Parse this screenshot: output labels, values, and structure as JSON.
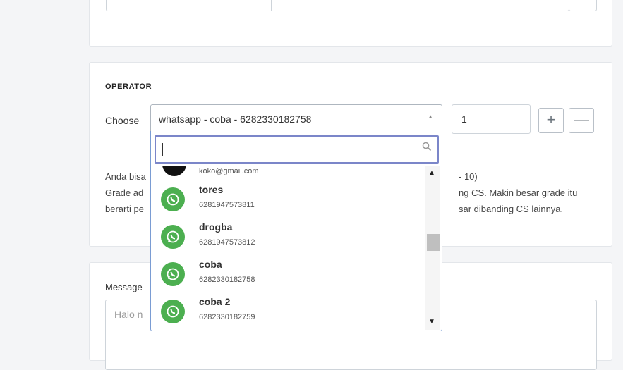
{
  "operator_section": {
    "title": "OPERATOR",
    "choose_label": "Choose",
    "selected_operator": "whatsapp - coba - 6282330182758",
    "quantity_value": "1",
    "plus_label": "+",
    "minus_label": "—",
    "info_line1_left": "Anda bisa",
    "info_line1_right": "- 10)",
    "info_line2_left": "Grade ad",
    "info_line2_right": "ng CS. Makin besar grade itu",
    "info_line3_left": "berarti pe",
    "info_line3_right": "sar dibanding CS lainnya."
  },
  "message_section": {
    "label": "Message",
    "textarea_placeholder": "Halo n"
  },
  "dropdown": {
    "search_value": "",
    "partial_item_email": "koko@gmail.com",
    "options": [
      {
        "name": "tores",
        "phone": "6281947573811",
        "icon": "whatsapp-icon"
      },
      {
        "name": "drogba",
        "phone": "6281947573812",
        "icon": "whatsapp-icon"
      },
      {
        "name": "coba",
        "phone": "6282330182758",
        "icon": "whatsapp-icon"
      },
      {
        "name": "coba 2",
        "phone": "6282330182759",
        "icon": "whatsapp-icon"
      }
    ]
  },
  "colors": {
    "whatsapp_green": "#4caf50",
    "focus_border": "#7b86c9",
    "page_background": "#f4f5f7"
  }
}
